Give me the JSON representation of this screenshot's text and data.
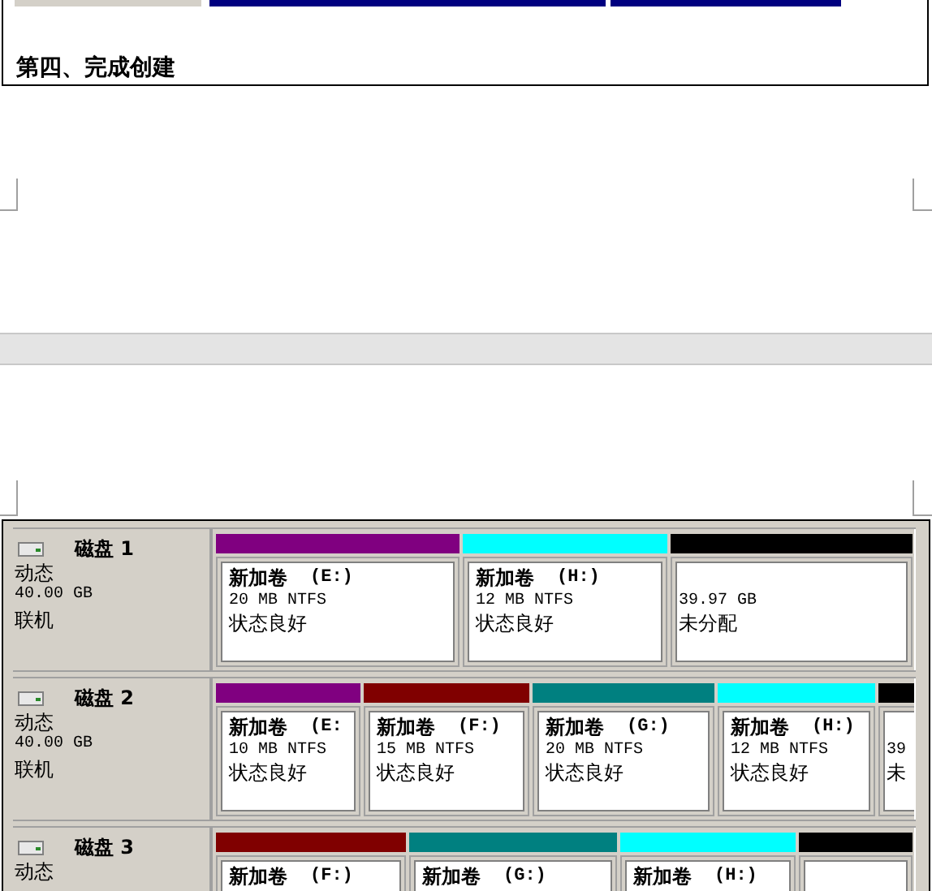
{
  "heading": "第四、完成创建",
  "disks": [
    {
      "name": "磁盘 1",
      "type": "动态",
      "size": "40.00 GB",
      "status": "联机",
      "partitions": [
        {
          "kind": "volume",
          "color": "#800080",
          "name": "新加卷",
          "letter": "(E:)",
          "size": "20 MB NTFS",
          "status": "状态良好"
        },
        {
          "kind": "volume",
          "color": "#00ffff",
          "name": "新加卷",
          "letter": "(H:)",
          "size": "12 MB NTFS",
          "status": "状态良好"
        },
        {
          "kind": "unallocated",
          "color": "#000000",
          "size": "39.97 GB",
          "status": "未分配"
        }
      ]
    },
    {
      "name": "磁盘 2",
      "type": "动态",
      "size": "40.00 GB",
      "status": "联机",
      "partitions": [
        {
          "kind": "volume",
          "color": "#800080",
          "name": "新加卷",
          "letter": "(E:",
          "size": "10 MB NTFS",
          "status": "状态良好"
        },
        {
          "kind": "volume",
          "color": "#800000",
          "name": "新加卷",
          "letter": "(F:)",
          "size": "15 MB NTFS",
          "status": "状态良好"
        },
        {
          "kind": "volume",
          "color": "#008080",
          "name": "新加卷",
          "letter": "(G:)",
          "size": "20 MB NTFS",
          "status": "状态良好"
        },
        {
          "kind": "volume",
          "color": "#00ffff",
          "name": "新加卷",
          "letter": "(H:)",
          "size": "12 MB NTFS",
          "status": "状态良好"
        },
        {
          "kind": "unallocated",
          "color": "#000000",
          "size": "39",
          "status": "未"
        }
      ]
    },
    {
      "name": "磁盘 3",
      "type": "动态",
      "partitions": [
        {
          "kind": "volume",
          "color": "#800000",
          "name": "新加卷",
          "letter": "(F:)"
        },
        {
          "kind": "volume",
          "color": "#008080",
          "name": "新加卷",
          "letter": "(G:)"
        },
        {
          "kind": "volume",
          "color": "#00ffff",
          "name": "新加卷",
          "letter": "(H:)"
        },
        {
          "kind": "unallocated",
          "color": "#000000"
        }
      ]
    }
  ]
}
